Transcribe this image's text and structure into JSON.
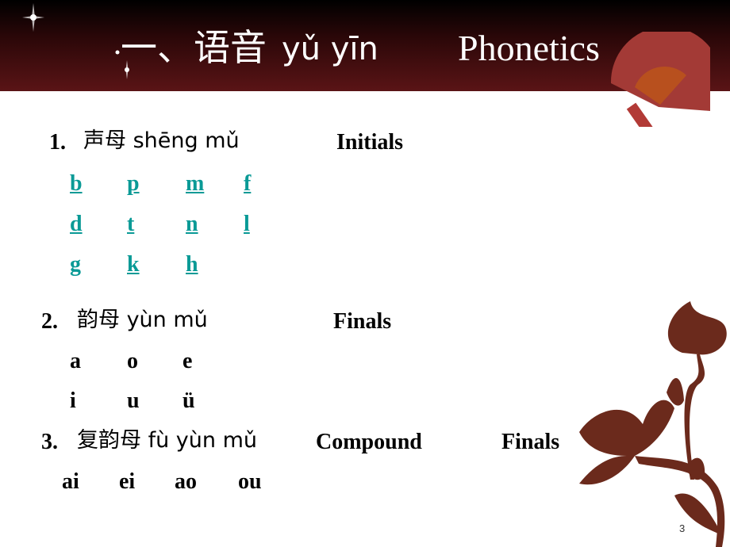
{
  "title": {
    "cn": "一、语音",
    "pinyin": "yǔ yīn",
    "en": "Phonetics"
  },
  "sections": [
    {
      "num": "1.",
      "cn": "声母 shēng mǔ",
      "en": "Initials"
    },
    {
      "num": "2.",
      "cn": "韵母 yùn mǔ",
      "en": "Finals"
    },
    {
      "num": "3.",
      "cn": "复韵母 fù yùn mǔ",
      "en": "Compound",
      "en2": "Finals"
    }
  ],
  "initials": [
    [
      "b",
      "p",
      "m",
      "f"
    ],
    [
      "d",
      "t",
      "n",
      "l"
    ],
    [
      "g",
      "k",
      "h"
    ]
  ],
  "finals": [
    [
      "a",
      "o",
      "e"
    ],
    [
      "i",
      "u",
      "ü"
    ]
  ],
  "compound_finals": [
    "ai",
    "ei",
    "ao",
    "ou"
  ],
  "page_number": "3",
  "colors": {
    "banner": "#5a1416",
    "link": "#0a9a96",
    "ornament": "#6b2a1c"
  }
}
